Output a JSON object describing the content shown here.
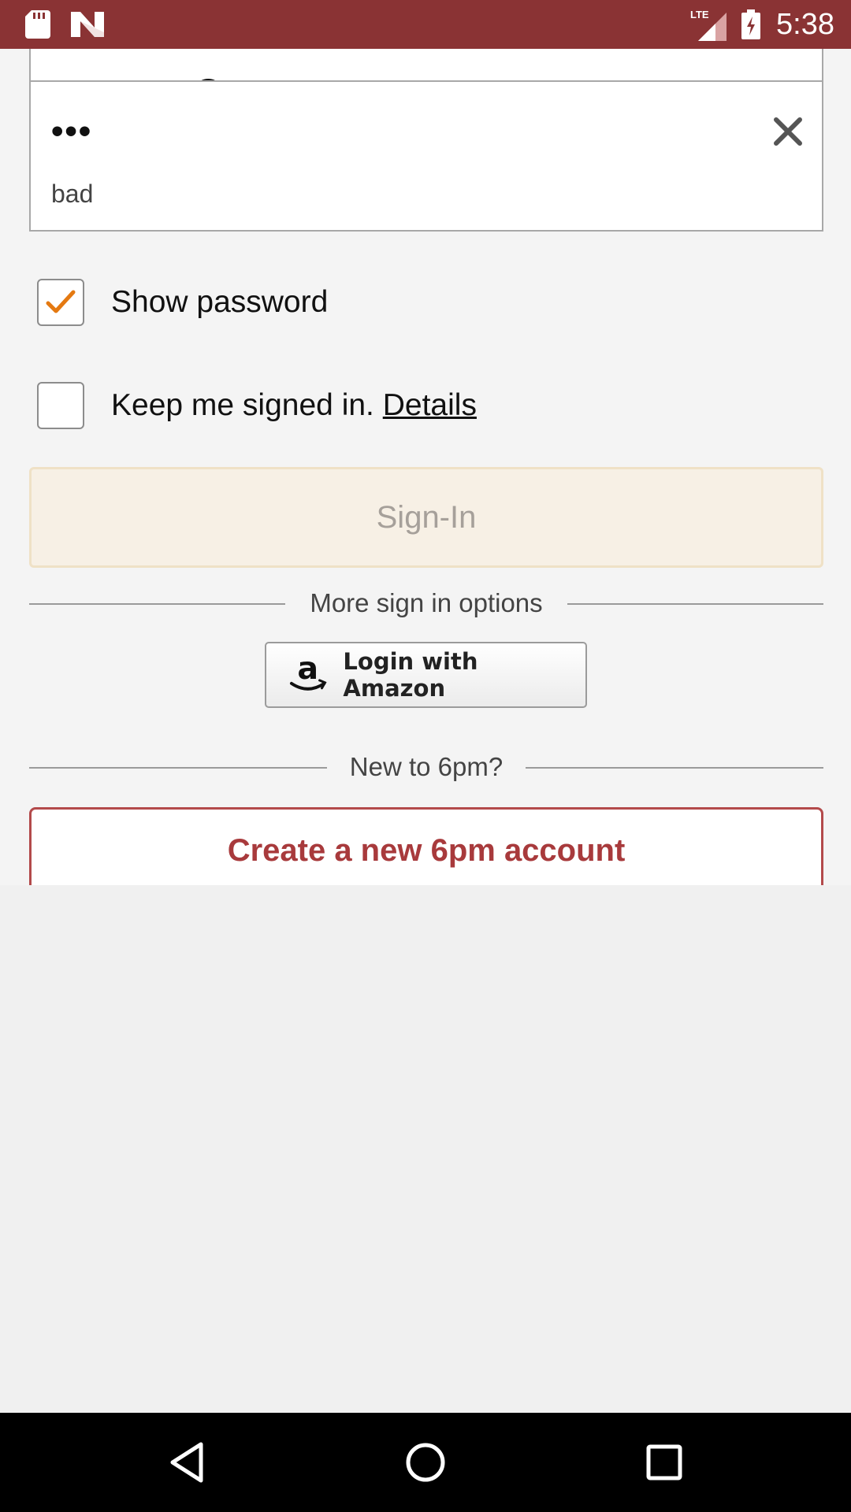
{
  "status_bar": {
    "time": "5:38",
    "left_icons": [
      "sd-card-icon",
      "n-notification-icon"
    ],
    "right_icons": [
      "lte-signal-icon",
      "battery-charging-icon"
    ],
    "lte_label": "LTE",
    "background": "#8a3334"
  },
  "signin_form": {
    "email_field": {
      "value": "…p…@g…",
      "visible_fragment": "p @g"
    },
    "password_field": {
      "masked_value": "•••",
      "strength_hint": "bad",
      "clear_icon": "close-icon"
    },
    "show_password": {
      "label": "Show password",
      "checked": true
    },
    "keep_signed_in": {
      "label": "Keep me signed in.",
      "link": "Details",
      "checked": false
    },
    "signin_button": {
      "label": "Sign-In",
      "enabled": false
    },
    "more_options_divider": "More sign in options",
    "amazon_button": {
      "label": "Login with Amazon",
      "icon": "amazon-logo-icon"
    },
    "new_divider": "New to 6pm?",
    "create_account_button": {
      "label": "Create a new 6pm account"
    }
  },
  "colors": {
    "brand": "#8a3334",
    "create_border": "#b34a4b",
    "create_text": "#a83a3c",
    "checkmark": "#e47911",
    "signin_disabled_bg": "#f7f0e5"
  },
  "nav_bar": {
    "buttons": [
      "back-icon",
      "home-icon",
      "recents-icon"
    ]
  }
}
